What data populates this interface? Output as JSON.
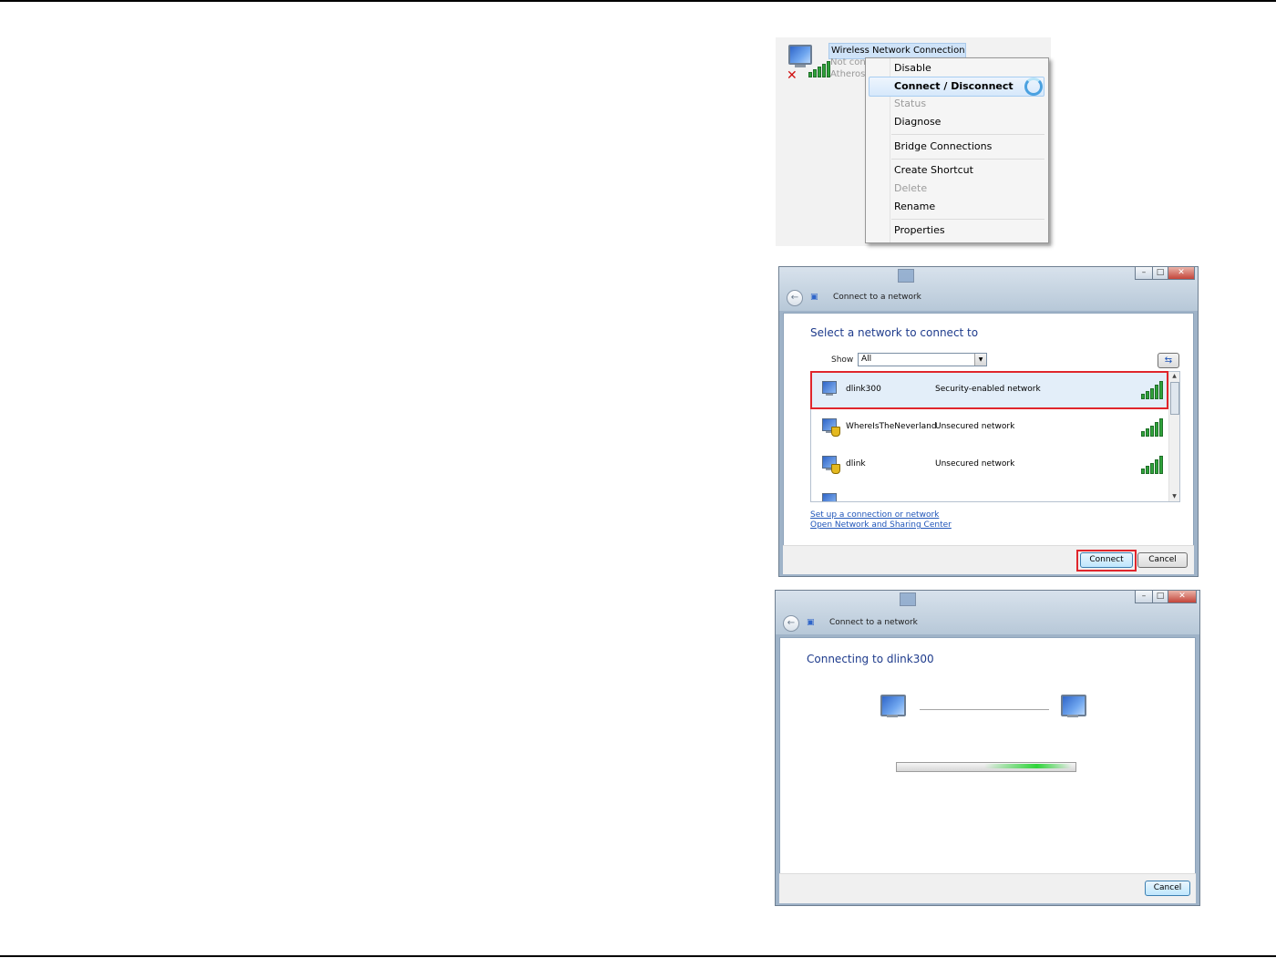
{
  "context_menu_panel": {
    "adapter": {
      "name": "Wireless Network Connection",
      "status": "Not con",
      "device": "Atheros"
    },
    "items": [
      {
        "label": "Disable",
        "enabled": true
      },
      {
        "label": "Connect / Disconnect",
        "enabled": true,
        "highlighted": true
      },
      {
        "label": "Status",
        "enabled": false
      },
      {
        "label": "Diagnose",
        "enabled": true
      },
      {
        "label": "Bridge Connections",
        "enabled": true
      },
      {
        "label": "Create Shortcut",
        "enabled": true
      },
      {
        "label": "Delete",
        "enabled": false
      },
      {
        "label": "Rename",
        "enabled": true
      },
      {
        "label": "Properties",
        "enabled": true
      }
    ]
  },
  "select_dialog": {
    "title": "Connect to a network",
    "heading": "Select a network to connect to",
    "show_label": "Show",
    "show_value": "All",
    "networks": [
      {
        "name": "dlink300",
        "security": "Security-enabled network",
        "selected": true,
        "signal_bars": 5
      },
      {
        "name": "WhereIsTheNeverland",
        "security": "Unsecured network",
        "selected": false,
        "signal_bars": 5
      },
      {
        "name": "dlink",
        "security": "Unsecured network",
        "selected": false,
        "signal_bars": 5
      }
    ],
    "links": [
      "Set up a connection or network",
      "Open Network and Sharing Center"
    ],
    "connect_label": "Connect",
    "cancel_label": "Cancel"
  },
  "connecting_dialog": {
    "title": "Connect to a network",
    "heading": "Connecting to dlink300",
    "cancel_label": "Cancel",
    "progress": "indeterminate"
  },
  "colors": {
    "accent_heading": "#1e3b8c",
    "highlight_red": "#e0262c",
    "signal_green": "#2fa23a"
  }
}
